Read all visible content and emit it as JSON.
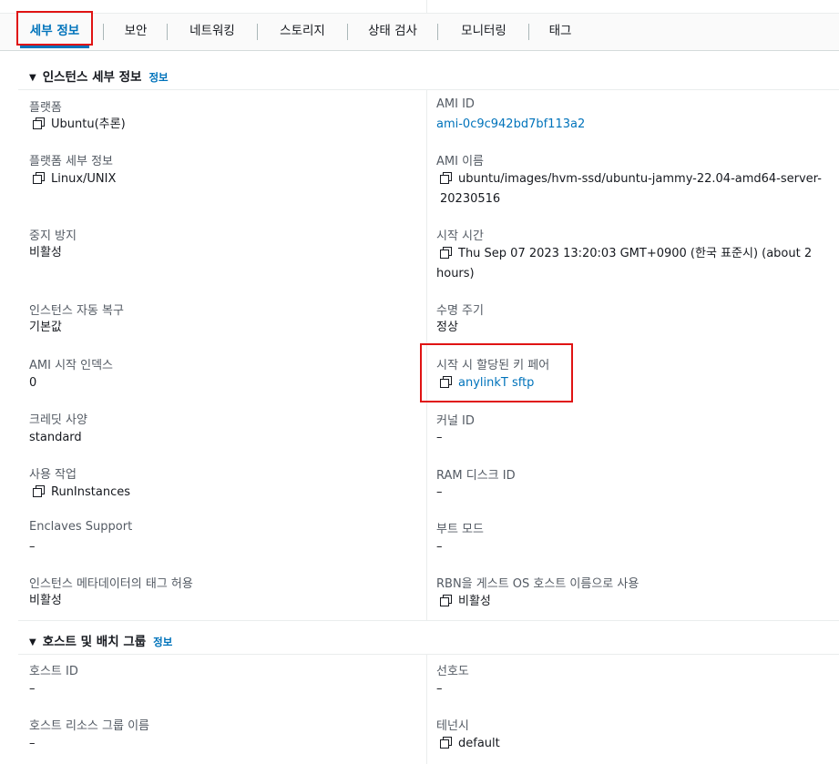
{
  "tabs": [
    {
      "label": "세부 정보"
    },
    {
      "label": "보안"
    },
    {
      "label": "네트워킹"
    },
    {
      "label": "스토리지"
    },
    {
      "label": "상태 검사"
    },
    {
      "label": "모니터링"
    },
    {
      "label": "태그"
    }
  ],
  "instance_section": {
    "title": "인스턴스 세부 정보",
    "info": "정보",
    "left": [
      {
        "label": "플랫폼",
        "value": "Ubuntu(추론)"
      },
      {
        "label": "플랫폼 세부 정보",
        "value": "Linux/UNIX"
      },
      {
        "label": "중지 방지",
        "value": "비활성"
      },
      {
        "label": "인스턴스 자동 복구",
        "value": "기본값"
      },
      {
        "label": "AMI 시작 인덱스",
        "value": "0"
      },
      {
        "label": "크레딧 사양",
        "value": "standard"
      },
      {
        "label": "사용 작업",
        "value": "RunInstances"
      },
      {
        "label": "Enclaves Support",
        "value": "–"
      },
      {
        "label": "인스턴스 메타데이터의 태그 허용",
        "value": "비활성"
      }
    ],
    "right": [
      {
        "label": "AMI ID",
        "value": "ami-0c9c942bd7bf113a2"
      },
      {
        "label": "AMI 이름",
        "value": "ubuntu/images/hvm-ssd/ubuntu-jammy-22.04-amd64-server-20230516"
      },
      {
        "label": "시작 시간",
        "value": "Thu Sep 07 2023 13:20:03 GMT+0900 (한국 표준시) (about 2 hours)"
      },
      {
        "label": "수명 주기",
        "value": "정상"
      },
      {
        "label": "시작 시 할당된 키 페어",
        "value": "anylinkT sftp"
      },
      {
        "label": "커널 ID",
        "value": "–"
      },
      {
        "label": "RAM 디스크 ID",
        "value": "–"
      },
      {
        "label": "부트 모드",
        "value": "–"
      },
      {
        "label": "RBN을 게스트 OS 호스트 이름으로 사용",
        "value": "비활성"
      }
    ]
  },
  "host_section": {
    "title": "호스트 및 배치 그룹",
    "info": "정보",
    "left": [
      {
        "label": "호스트 ID",
        "value": "–"
      },
      {
        "label": "호스트 리소스 그룹 이름",
        "value": "–"
      }
    ],
    "right": [
      {
        "label": "선호도",
        "value": "–"
      },
      {
        "label": "테넌시",
        "value": "default"
      }
    ]
  },
  "colors": {
    "accent": "#0073bb",
    "highlight": "#e01313"
  }
}
